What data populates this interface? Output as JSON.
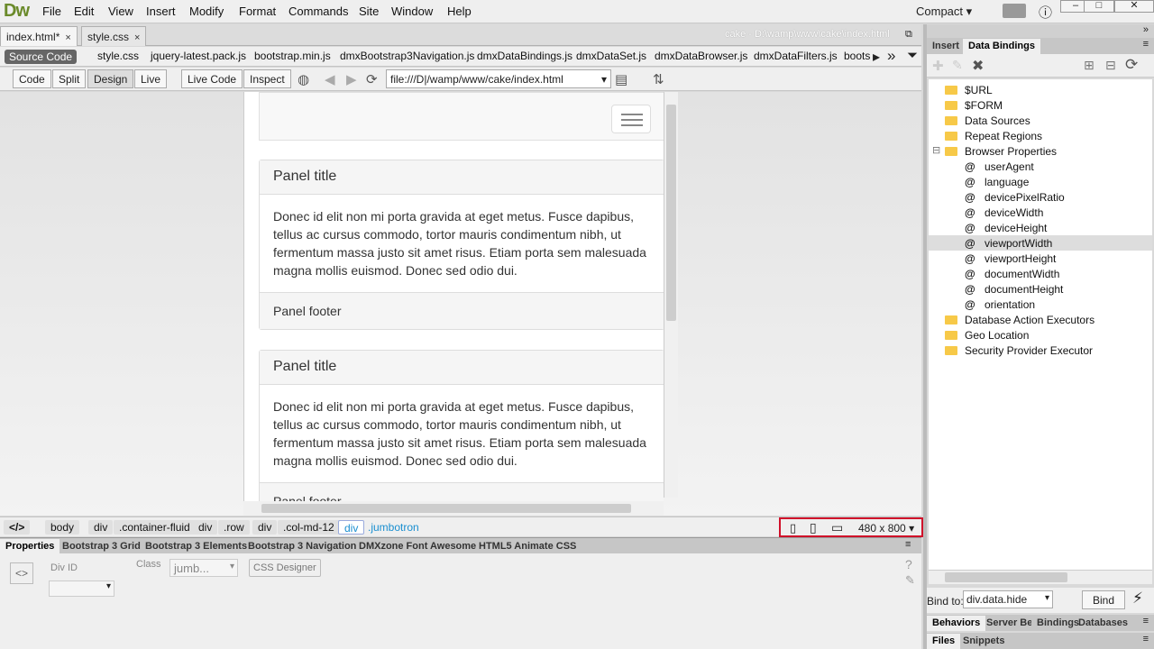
{
  "app": {
    "logo": "Dw"
  },
  "menu": [
    "File",
    "Edit",
    "View",
    "Insert",
    "Modify",
    "Format",
    "Commands",
    "Site",
    "Window",
    "Help"
  ],
  "workspace": "Compact",
  "doc_tabs": [
    {
      "label": "index.html*",
      "close": "×"
    },
    {
      "label": "style.css",
      "close": "×"
    }
  ],
  "doc_path": "cake - D:\\wamp\\www\\cake\\index.html",
  "related_files": {
    "source": "Source Code",
    "files": [
      "style.css",
      "jquery-latest.pack.js",
      "bootstrap.min.js",
      "dmxBootstrap3Navigation.js",
      "dmxDataBindings.js",
      "dmxDataSet.js",
      "dmxDataBrowser.js",
      "dmxDataFilters.js",
      "boots"
    ]
  },
  "toolbar": {
    "buttons": [
      "Code",
      "Split",
      "Design",
      "Live"
    ],
    "live_code": "Live Code",
    "inspect": "Inspect",
    "url": "file:///D|/wamp/www/cake/index.html"
  },
  "page": {
    "panels": [
      {
        "title": "Panel title",
        "body": "Donec id elit non mi porta gravida at eget metus. Fusce dapibus, tellus ac cursus commodo, tortor mauris condimentum nibh, ut fermentum massa justo sit amet risus. Etiam porta sem malesuada magna mollis euismod. Donec sed odio dui.",
        "footer": "Panel footer"
      },
      {
        "title": "Panel title",
        "body": "Donec id elit non mi porta gravida at eget metus. Fusce dapibus, tellus ac cursus commodo, tortor mauris condimentum nibh, ut fermentum massa justo sit amet risus. Etiam porta sem malesuada magna mollis euismod. Donec sed odio dui.",
        "footer": "Panel footer"
      }
    ]
  },
  "tagbar": {
    "code_toggle": "</>",
    "tags": [
      "body",
      "div",
      ".container-fluid",
      "div",
      ".row",
      "div",
      ".col-md-12",
      "div",
      ".jumbotron"
    ],
    "size": "480 x 800"
  },
  "properties": {
    "tabs": [
      "Properties",
      "Bootstrap 3 Grid",
      "Bootstrap 3 Elements",
      "Bootstrap 3 Navigation",
      "DMXzone Font Awesome",
      "HTML5 Animate CSS"
    ],
    "div_id_label": "Div ID",
    "class_label": "Class",
    "class_value": "jumb...",
    "css_designer": "CSS Designer"
  },
  "right_panel": {
    "tabs": [
      "Insert",
      "Data Bindings"
    ],
    "tree": [
      {
        "type": "folder",
        "label": "$URL",
        "depth": 0
      },
      {
        "type": "folder",
        "label": "$FORM",
        "depth": 0
      },
      {
        "type": "folder",
        "label": "Data Sources",
        "depth": 0
      },
      {
        "type": "folder",
        "label": "Repeat Regions",
        "depth": 0
      },
      {
        "type": "folder",
        "label": "Browser Properties",
        "depth": 0,
        "expanded": true
      },
      {
        "type": "prop",
        "label": "userAgent",
        "depth": 1
      },
      {
        "type": "prop",
        "label": "language",
        "depth": 1
      },
      {
        "type": "prop",
        "label": "devicePixelRatio",
        "depth": 1
      },
      {
        "type": "prop",
        "label": "deviceWidth",
        "depth": 1
      },
      {
        "type": "prop",
        "label": "deviceHeight",
        "depth": 1
      },
      {
        "type": "prop",
        "label": "viewportWidth",
        "depth": 1,
        "selected": true
      },
      {
        "type": "prop",
        "label": "viewportHeight",
        "depth": 1
      },
      {
        "type": "prop",
        "label": "documentWidth",
        "depth": 1
      },
      {
        "type": "prop",
        "label": "documentHeight",
        "depth": 1
      },
      {
        "type": "prop",
        "label": "orientation",
        "depth": 1
      },
      {
        "type": "folder",
        "label": "Database Action Executors",
        "depth": 0
      },
      {
        "type": "folder",
        "label": "Geo Location",
        "depth": 0
      },
      {
        "type": "folder",
        "label": "Security Provider Executor",
        "depth": 0
      }
    ],
    "bind_to_label": "Bind to:",
    "bind_to_value": "div.data.hide",
    "bind_button": "Bind",
    "bottom_tabs1": [
      "Behaviors",
      "Server Beh",
      "Bindings",
      "Databases"
    ],
    "bottom_tabs2": [
      "Files",
      "Snippets"
    ]
  }
}
